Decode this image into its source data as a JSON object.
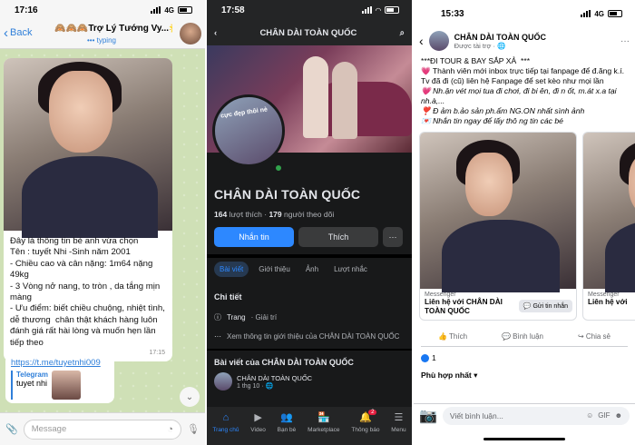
{
  "telegram": {
    "time": "17:16",
    "network": "4G",
    "back_label": "Back",
    "chat_title": "🙈🙈🙈Trợ Lý Tướng Vy...🌟",
    "status": "typing",
    "message_lines": [
      "Đây là thông tin bé anh vừa chọn",
      "Tên : tuyết Nhi -Sinh năm 2001",
      "- Chiều cao và cân nặng: 1m64 nặng 49kg",
      "- 3 Vòng nở nang, to tròn , da tắng mịn màng",
      "- Ưu điểm: biết chiều chuộng, nhiệt tình, dễ thương  chân thật khách hàng luôn đánh giá rất hài lòng và muốn hẹn lần tiếp theo"
    ],
    "message_time": "17:15",
    "link_url": "https://t.me/tuyetnhi009",
    "link_site": "Telegram",
    "link_name": "tuyet nhi",
    "input_placeholder": "Message"
  },
  "facebook_page": {
    "time": "17:58",
    "header_title": "CHÂN DÀI TOÀN QUỐC",
    "profile_text": "cực đẹp thôi nè",
    "page_name": "CHÂN DÀI TOÀN QUỐC",
    "likes_count": "164",
    "likes_label": "lượt thích",
    "followers_count": "179",
    "followers_label": "người theo dõi",
    "message_button": "Nhắn tin",
    "like_button": "Thích",
    "more_button": "···",
    "tabs": [
      "Bài viết",
      "Giới thiệu",
      "Ảnh",
      "Lượt nhắc"
    ],
    "details_title": "Chi tiết",
    "category_prefix": "Trang",
    "category": "· Giải trí",
    "see_about": "Xem thông tin giới thiệu của CHÂN DÀI TOÀN QUỐC",
    "posts_title": "Bài viết của CHÂN DÀI TOÀN QUỐC",
    "post_author": "CHÂN DÀI TOÀN QUỐC",
    "post_meta": "1 thg 10 · 🌐",
    "nav": [
      {
        "label": "Trang chủ",
        "icon": "⌂"
      },
      {
        "label": "Video",
        "icon": "▶"
      },
      {
        "label": "Bạn bè",
        "icon": "👥"
      },
      {
        "label": "Marketplace",
        "icon": "🏪"
      },
      {
        "label": "Thông báo",
        "icon": "🔔"
      },
      {
        "label": "Menu",
        "icon": "☰"
      }
    ],
    "notification_badge": "2"
  },
  "facebook_post": {
    "time": "15:33",
    "network": "4G",
    "page_name": "CHÂN DÀI TOÀN QUỐC",
    "sponsored": "Được tài trợ · 🌐",
    "post_lines": [
      "***ĐI TOUR & BAY SẮP XẢ  ***",
      "💗 Thành viên mới inbox trực tiếp tại fanpage để đ.ăng k.í.",
      "Tv đã đi (cũ) liên hệ Fanpage để set kèo như mọi lần",
      "💗 Nh.ận vét mọi tua đi chơi, đi bi ên, đi n ốt, m.át x.a tại nh.à,...",
      "❣️ Đ ảm b.ảo sản ph.ẩm NG.ON nhất sình ảnh",
      "💌 Nhắn tin ngay để lấy thô ng tin các bé"
    ],
    "card_source": "Messenger",
    "card_title": "Liên hệ với CHÂN DÀI TOÀN QUỐC",
    "card_button": "Gửi tin nhắn",
    "card2_title": "Liên hệ với",
    "actions": [
      "Thích",
      "Bình luận",
      "Chia sẻ"
    ],
    "like_count": "1",
    "relevant": "Phù hợp nhất",
    "comment_placeholder": "Viết bình luận...",
    "gif_label": "GIF"
  }
}
